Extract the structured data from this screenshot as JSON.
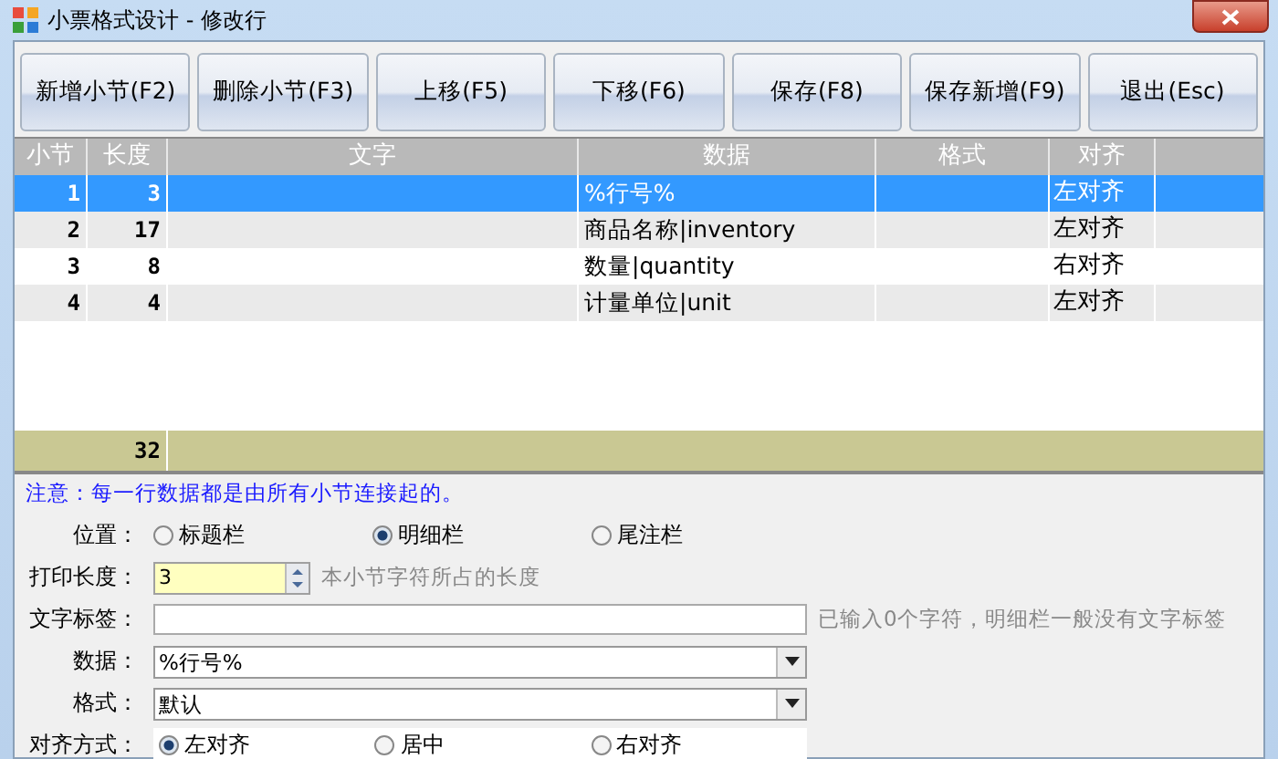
{
  "window": {
    "title": "小票格式设计 - 修改行"
  },
  "toolbar": [
    "新增小节(F2)",
    "删除小节(F3)",
    "上移(F5)",
    "下移(F6)",
    "保存(F8)",
    "保存新增(F9)",
    "退出(Esc)"
  ],
  "table": {
    "columns": [
      "小节",
      "长度",
      "文字",
      "数据",
      "格式",
      "对齐"
    ],
    "rows": [
      {
        "selected": true,
        "cells": [
          "1",
          "3",
          "",
          "%行号%",
          "",
          "左对齐"
        ]
      },
      {
        "selected": false,
        "cells": [
          "2",
          "17",
          "",
          "商品名称|inventory",
          "",
          "左对齐"
        ]
      },
      {
        "selected": false,
        "cells": [
          "3",
          "8",
          "",
          "数量|quantity",
          "",
          "右对齐"
        ]
      },
      {
        "selected": false,
        "cells": [
          "4",
          "4",
          "",
          "计量单位|unit",
          "",
          "左对齐"
        ]
      }
    ],
    "total": "32"
  },
  "form": {
    "note": "注意：每一行数据都是由所有小节连接起的。",
    "position": {
      "label": "位置：",
      "options": [
        {
          "label": "标题栏",
          "selected": false
        },
        {
          "label": "明细栏",
          "selected": true
        },
        {
          "label": "尾注栏",
          "selected": false
        }
      ]
    },
    "print_length": {
      "label": "打印长度：",
      "value": "3",
      "hint": "本小节字符所占的长度"
    },
    "text_label": {
      "label": "文字标签：",
      "hint": "已输入0个字符，明细栏一般没有文字标签"
    },
    "data": {
      "label": "数据：",
      "value": "%行号%"
    },
    "format": {
      "label": "格式：",
      "value": "默认"
    },
    "align": {
      "label": "对齐方式：",
      "options": [
        {
          "label": "左对齐",
          "selected": true
        },
        {
          "label": "居中",
          "selected": false
        },
        {
          "label": "右对齐",
          "selected": false
        }
      ]
    }
  }
}
